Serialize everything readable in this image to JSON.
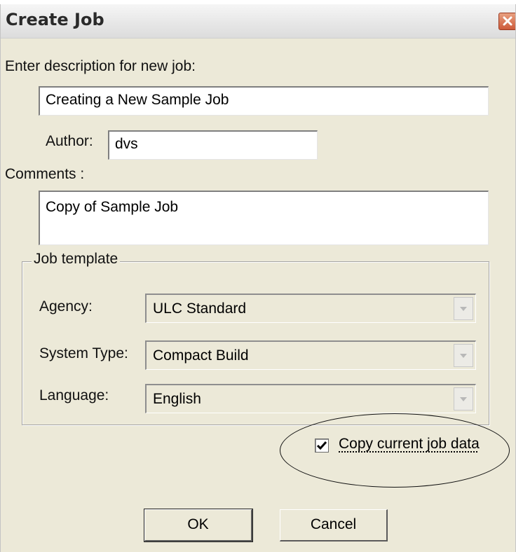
{
  "window": {
    "title": "Create Job",
    "close_icon": "close-x-icon"
  },
  "description": {
    "label": "Enter description for new job:",
    "value": "Creating a New Sample Job"
  },
  "author": {
    "label": "Author:",
    "value": "dvs"
  },
  "comments": {
    "label": "Comments :",
    "value": "Copy of Sample Job"
  },
  "job_template": {
    "legend": "Job template",
    "agency": {
      "label": "Agency:",
      "value": "ULC Standard"
    },
    "system_type": {
      "label": "System Type:",
      "value": "Compact Build"
    },
    "language": {
      "label": "Language:",
      "value": "English"
    }
  },
  "copy_data": {
    "label": "Copy current job data",
    "checked": true
  },
  "buttons": {
    "ok": "OK",
    "cancel": "Cancel"
  },
  "colors": {
    "dialog_bg": "#ece9d8",
    "close_button": "#cd5a3a"
  }
}
